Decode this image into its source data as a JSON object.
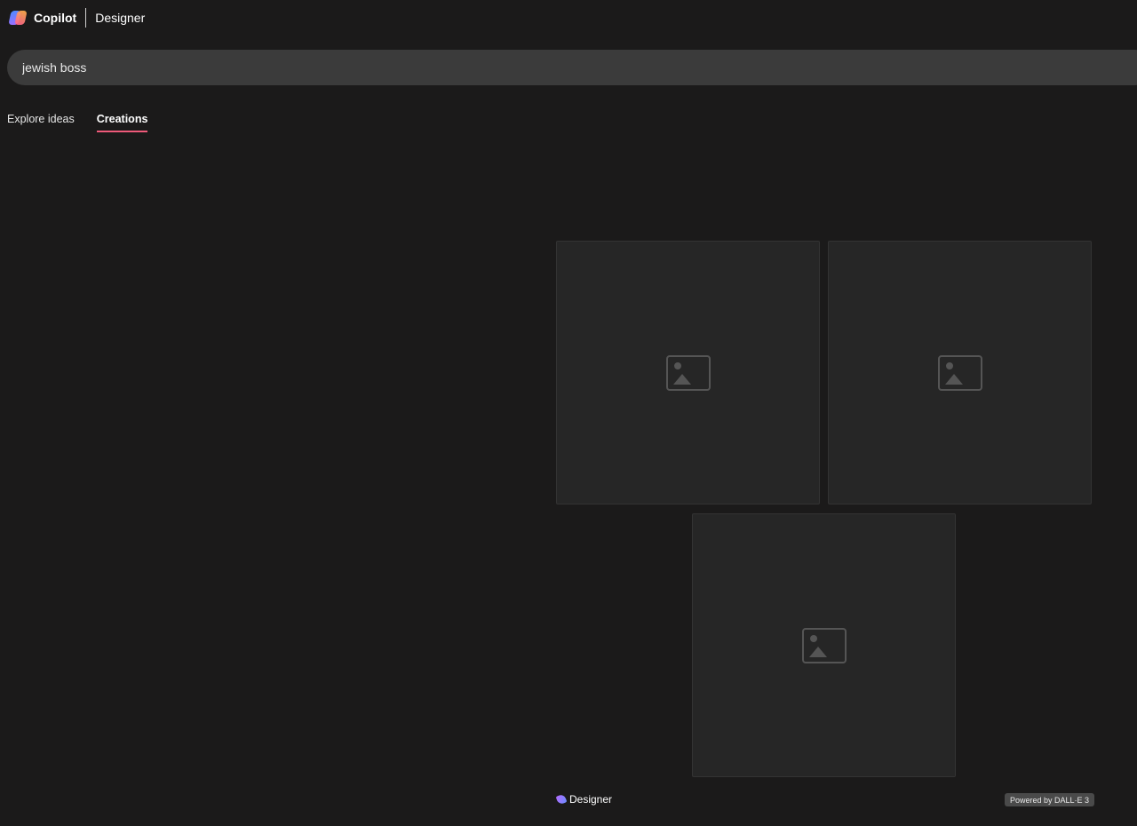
{
  "header": {
    "brand": "Copilot",
    "product": "Designer"
  },
  "search": {
    "value": "jewish boss"
  },
  "tabs": [
    {
      "label": "Explore ideas",
      "active": false
    },
    {
      "label": "Creations",
      "active": true
    }
  ],
  "gallery": {
    "image_count": 3
  },
  "footer": {
    "designer_label": "Designer",
    "powered_by": "Powered by DALL·E 3"
  },
  "colors": {
    "background": "#1b1a1a",
    "search_bg": "#3b3b3b",
    "tab_underline": "#ef5a7a"
  }
}
